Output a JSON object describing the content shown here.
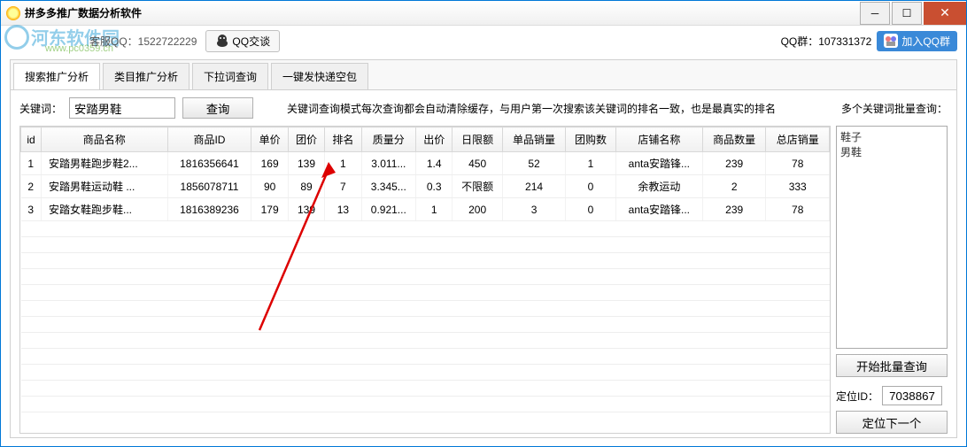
{
  "window": {
    "title": "拼多多推广数据分析软件"
  },
  "watermark": {
    "main": "河东软件园",
    "sub": "www.pc0359.cn"
  },
  "topbar": {
    "kefu_label": "客服QQ：1522722229",
    "qq_chat": "QQ交谈",
    "qq_group_label": "QQ群：107331372",
    "join_qq": "加入QQ群"
  },
  "tabs": [
    "搜索推广分析",
    "类目推广分析",
    "下拉词查询",
    "一键发快递空包"
  ],
  "query": {
    "kw_label": "关键词：",
    "kw_value": "安踏男鞋",
    "btn": "查询",
    "hint": "关键词查询模式每次查询都会自动清除缓存，与用户第一次搜索该关键词的排名一致，也是最真实的排名",
    "batch_label": "多个关键词批量查询："
  },
  "table": {
    "columns": [
      "id",
      "商品名称",
      "商品ID",
      "单价",
      "团价",
      "排名",
      "质量分",
      "出价",
      "日限额",
      "单品销量",
      "团购数",
      "店铺名称",
      "商品数量",
      "总店销量"
    ],
    "rows": [
      {
        "id": "1",
        "name": "安踏男鞋跑步鞋2...",
        "pid": "1816356641",
        "price": "169",
        "group": "139",
        "rank": "1",
        "qs": "3.011...",
        "bid": "1.4",
        "limit": "450",
        "sales": "52",
        "groupn": "1",
        "shop": "anta安踏锋...",
        "count": "239",
        "total": "78"
      },
      {
        "id": "2",
        "name": "安踏男鞋运动鞋 ...",
        "pid": "1856078711",
        "price": "90",
        "group": "89",
        "rank": "7",
        "qs": "3.345...",
        "bid": "0.3",
        "limit": "不限额",
        "sales": "214",
        "groupn": "0",
        "shop": "余教运动",
        "count": "2",
        "total": "333"
      },
      {
        "id": "3",
        "name": "安踏女鞋跑步鞋...",
        "pid": "1816389236",
        "price": "179",
        "group": "139",
        "rank": "13",
        "qs": "0.921...",
        "bid": "1",
        "limit": "200",
        "sales": "3",
        "groupn": "0",
        "shop": "anta安踏锋...",
        "count": "239",
        "total": "78"
      }
    ]
  },
  "batch": {
    "lines": "鞋子\n男鞋",
    "start_btn": "开始批量查询",
    "locate_label": "定位ID：",
    "locate_value": "7038867",
    "next_btn": "定位下一个"
  }
}
